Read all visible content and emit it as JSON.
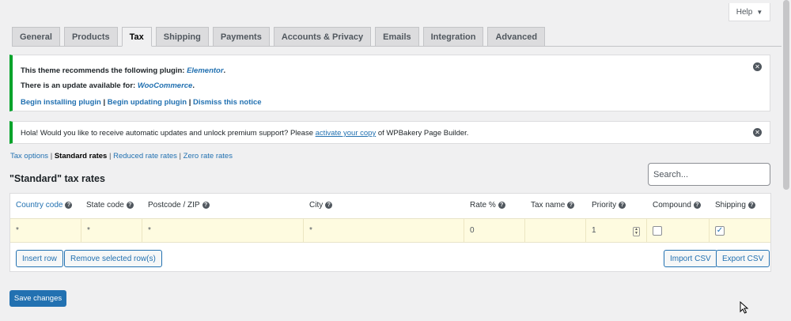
{
  "help": {
    "label": "Help",
    "caret": "▼"
  },
  "tabs": [
    {
      "label": "General"
    },
    {
      "label": "Products"
    },
    {
      "label": "Tax"
    },
    {
      "label": "Shipping"
    },
    {
      "label": "Payments"
    },
    {
      "label": "Accounts & Privacy"
    },
    {
      "label": "Emails"
    },
    {
      "label": "Integration"
    },
    {
      "label": "Advanced"
    }
  ],
  "notice1": {
    "line1_prefix": "This theme recommends the following plugin: ",
    "line1_link": "Elementor",
    "line1_suffix": ".",
    "line2_prefix": "There is an update available for: ",
    "line2_link": "WooCommerce",
    "line2_suffix": ".",
    "action1": "Begin installing plugin",
    "sep1": " | ",
    "action2": "Begin updating plugin",
    "sep2": " | ",
    "action3": "Dismiss this notice"
  },
  "notice2": {
    "prefix": "Hola! Would you like to receive automatic updates and unlock premium support? Please ",
    "link": "activate your copy",
    "suffix": " of WPBakery Page Builder."
  },
  "subnav": {
    "tax_options": "Tax options",
    "sep1": " | ",
    "standard": "Standard rates",
    "sep2": " | ",
    "reduced": "Reduced rate rates",
    "sep3": " | ",
    "zero": "Zero rate rates"
  },
  "section_title": "\"Standard\" tax rates",
  "search": {
    "placeholder": "Search..."
  },
  "columns": {
    "country": "Country code",
    "state": "State code",
    "postcode": "Postcode / ZIP",
    "city": "City",
    "rate": "Rate %",
    "tax_name": "Tax name",
    "priority": "Priority",
    "compound": "Compound",
    "shipping": "Shipping"
  },
  "row": {
    "country": "*",
    "state": "*",
    "postcode": "*",
    "city": "*",
    "rate": "0",
    "tax_name": "",
    "priority": "1",
    "compound": false,
    "shipping": true
  },
  "buttons": {
    "insert_row": "Insert row",
    "remove_rows": "Remove selected row(s)",
    "import_csv": "Import CSV",
    "export_csv": "Export CSV",
    "save_changes": "Save changes"
  },
  "icons": {
    "help": "help-icon",
    "dismiss": "dismiss-icon",
    "check": "✓"
  },
  "colors": {
    "accent": "#2271b1",
    "notice_border": "#00a32a",
    "row_highlight": "#fefbe0"
  }
}
